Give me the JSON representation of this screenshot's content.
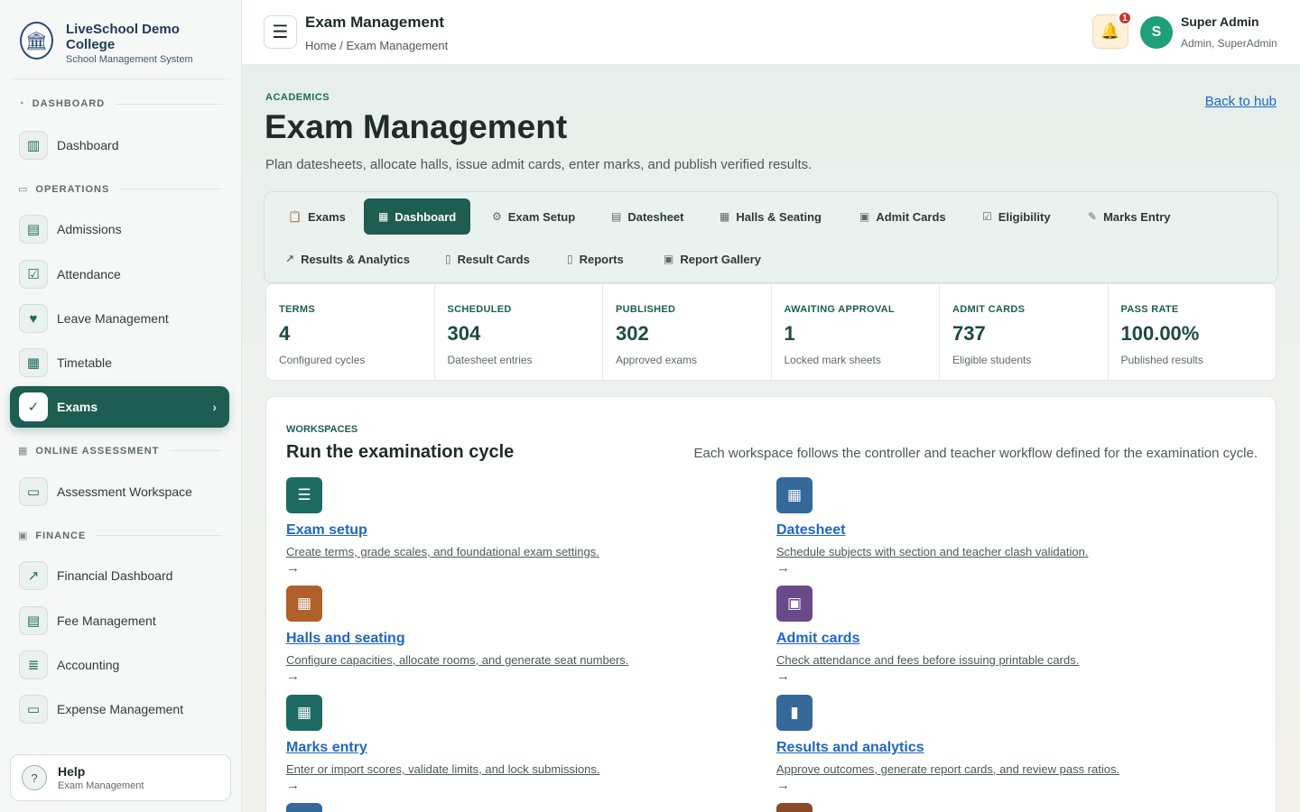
{
  "brand": {
    "name": "LiveSchool Demo College",
    "subtitle": "School Management System"
  },
  "sidebar": {
    "sections": [
      {
        "label": "DASHBOARD",
        "icon": "speedometer-icon"
      },
      {
        "label": "OPERATIONS",
        "icon": "briefcase-icon"
      },
      {
        "label": "ONLINE ASSESSMENT",
        "icon": "grid-icon"
      },
      {
        "label": "FINANCE",
        "icon": "wallet-icon"
      }
    ],
    "items": [
      {
        "label": "Dashboard",
        "icon": "layout-icon"
      },
      {
        "label": "Admissions",
        "icon": "id-card-icon"
      },
      {
        "label": "Attendance",
        "icon": "calendar-check-icon"
      },
      {
        "label": "Leave Management",
        "icon": "calendar-heart-icon"
      },
      {
        "label": "Timetable",
        "icon": "calendar-icon"
      },
      {
        "label": "Exams",
        "icon": "clipboard-check-icon",
        "active": true
      },
      {
        "label": "Assessment Workspace",
        "icon": "laptop-icon"
      },
      {
        "label": "Financial Dashboard",
        "icon": "line-chart-icon"
      },
      {
        "label": "Fee Management",
        "icon": "receipt-icon"
      },
      {
        "label": "Accounting",
        "icon": "ledger-icon"
      },
      {
        "label": "Expense Management",
        "icon": "wallet-icon"
      }
    ],
    "help": {
      "title": "Help",
      "subtitle": "Exam Management"
    }
  },
  "topbar": {
    "title": "Exam Management",
    "breadcrumb": "Home / Exam Management",
    "notification_count": "1",
    "user": {
      "initial": "S",
      "name": "Super Admin",
      "role": "Admin, SuperAdmin"
    }
  },
  "page": {
    "kicker": "ACADEMICS",
    "title": "Exam Management",
    "lead": "Plan datesheets, allocate halls, issue admit cards, enter marks, and publish verified results.",
    "back_link": "Back to hub"
  },
  "tabs": [
    {
      "label": "Exams",
      "icon": "clipboard-icon"
    },
    {
      "label": "Dashboard",
      "icon": "grid-icon",
      "active": true
    },
    {
      "label": "Exam Setup",
      "icon": "gear-icon"
    },
    {
      "label": "Datesheet",
      "icon": "calendar-icon"
    },
    {
      "label": "Halls & Seating",
      "icon": "table-icon"
    },
    {
      "label": "Admit Cards",
      "icon": "id-card-icon"
    },
    {
      "label": "Eligibility",
      "icon": "check-square-icon"
    },
    {
      "label": "Marks Entry",
      "icon": "edit-icon"
    },
    {
      "label": "Results & Analytics",
      "icon": "line-chart-icon"
    },
    {
      "label": "Result Cards",
      "icon": "file-icon"
    },
    {
      "label": "Reports",
      "icon": "report-icon"
    },
    {
      "label": "Report Gallery",
      "icon": "image-icon"
    }
  ],
  "stats": [
    {
      "label": "TERMS",
      "value": "4",
      "desc": "Configured cycles"
    },
    {
      "label": "SCHEDULED",
      "value": "304",
      "desc": "Datesheet entries"
    },
    {
      "label": "PUBLISHED",
      "value": "302",
      "desc": "Approved exams"
    },
    {
      "label": "AWAITING APPROVAL",
      "value": "1",
      "desc": "Locked mark sheets"
    },
    {
      "label": "ADMIT CARDS",
      "value": "737",
      "desc": "Eligible students"
    },
    {
      "label": "PASS RATE",
      "value": "100.00%",
      "desc": "Published results"
    }
  ],
  "workspaces": {
    "kicker": "WORKSPACES",
    "title": "Run the examination cycle",
    "note": "Each workspace follows the controller and teacher workflow defined for the examination cycle.",
    "arrow": "→",
    "cards": [
      {
        "title": "Exam setup",
        "desc": "Create terms, grade scales, and foundational exam settings.",
        "icon": "sliders-icon",
        "color": "#1d6b62"
      },
      {
        "title": "Datesheet",
        "desc": "Schedule subjects with section and teacher clash validation.",
        "icon": "calendar-icon",
        "color": "#34699a"
      },
      {
        "title": "Halls and seating",
        "desc": "Configure capacities, allocate rooms, and generate seat numbers.",
        "icon": "grid-icon",
        "color": "#b0602a"
      },
      {
        "title": "Admit cards",
        "desc": "Check attendance and fees before issuing printable cards.",
        "icon": "id-card-icon",
        "color": "#6b4a8a"
      },
      {
        "title": "Marks entry",
        "desc": "Enter or import scores, validate limits, and lock submissions.",
        "icon": "table-icon",
        "color": "#1d6b62"
      },
      {
        "title": "Results and analytics",
        "desc": "Approve outcomes, generate report cards, and review pass ratios.",
        "icon": "bar-chart-icon",
        "color": "#34699a"
      }
    ]
  }
}
